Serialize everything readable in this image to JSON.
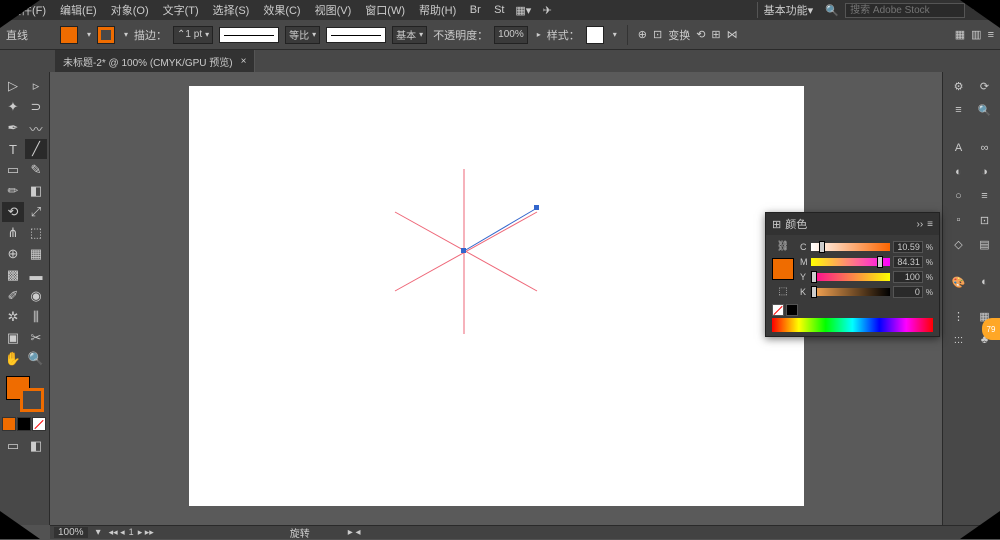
{
  "menu": {
    "file": "文件(F)",
    "edit": "编辑(E)",
    "object": "对象(O)",
    "text": "文字(T)",
    "select": "选择(S)",
    "effect": "效果(C)",
    "view": "视图(V)",
    "window": "窗口(W)",
    "help": "帮助(H)"
  },
  "workspace": {
    "label": "基本功能"
  },
  "search": {
    "placeholder": "搜索 Adobe Stock"
  },
  "optbar": {
    "toolname": "直线",
    "stroke_label": "描边：",
    "stroke_val": "1 pt",
    "ratio": "等比",
    "basic": "基本",
    "opacity_label": "不透明度：",
    "opacity_val": "100%",
    "style_label": "样式：",
    "transform": "变换"
  },
  "tab": {
    "title": "未标题-2* @ 100% (CMYK/GPU 预览)"
  },
  "colorpanel": {
    "title": "颜色",
    "c": {
      "label": "C",
      "val": "10.59"
    },
    "m": {
      "label": "M",
      "val": "84.31"
    },
    "y": {
      "label": "Y",
      "val": "100"
    },
    "k": {
      "label": "K",
      "val": "0"
    }
  },
  "status": {
    "zoom": "100%",
    "page": "1",
    "tooltext": "旋转"
  },
  "badge": "79"
}
